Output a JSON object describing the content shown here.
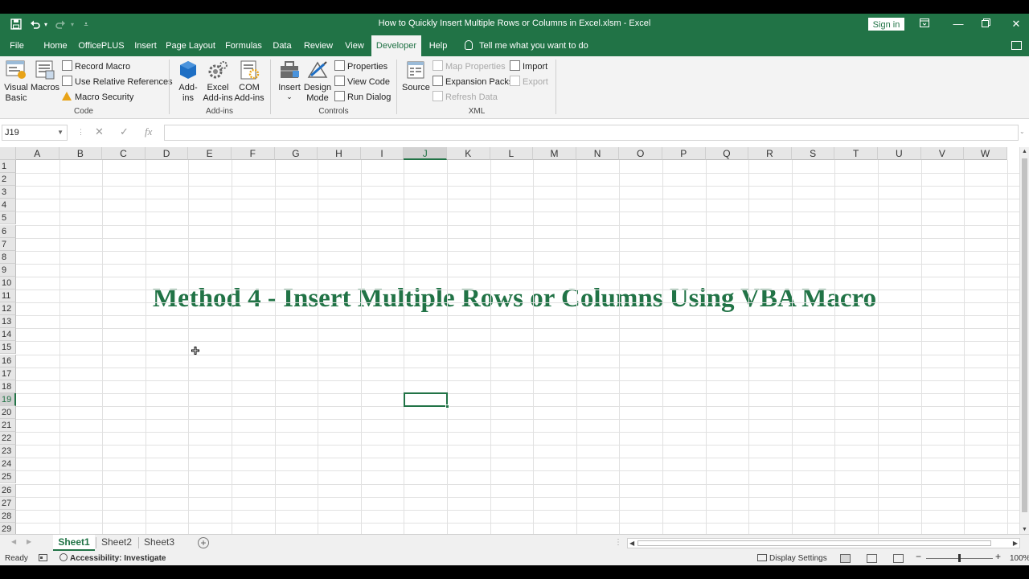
{
  "window": {
    "title": "How to Quickly Insert Multiple Rows or Columns in Excel.xlsm  -  Excel",
    "sign_in": "Sign in"
  },
  "tabs": [
    "File",
    "Home",
    "OfficePLUS",
    "Insert",
    "Page Layout",
    "Formulas",
    "Data",
    "Review",
    "View",
    "Developer",
    "Help"
  ],
  "active_tab": "Developer",
  "tell_me": "Tell me what you want to do",
  "ribbon": {
    "code": {
      "visual_basic_1": "Visual",
      "visual_basic_2": "Basic",
      "macros": "Macros",
      "record_macro": "Record Macro",
      "use_relative": "Use Relative References",
      "macro_security": "Macro Security",
      "label": "Code"
    },
    "addins": {
      "addins_1": "Add-",
      "addins_2": "ins",
      "excel_addins_1": "Excel",
      "excel_addins_2": "Add-ins",
      "com_addins_1": "COM",
      "com_addins_2": "Add-ins",
      "label": "Add-ins"
    },
    "controls": {
      "insert": "Insert",
      "insert_arrow": "⌄",
      "design_mode_1": "Design",
      "design_mode_2": "Mode",
      "properties": "Properties",
      "view_code": "View Code",
      "run_dialog": "Run Dialog",
      "label": "Controls"
    },
    "xml": {
      "source": "Source",
      "map_properties": "Map Properties",
      "expansion_packs": "Expansion Packs",
      "refresh_data": "Refresh Data",
      "import": "Import",
      "export": "Export",
      "label": "XML"
    }
  },
  "formula_bar": {
    "name_box": "J19",
    "fx": "fx",
    "cancel": "✕",
    "enter": "✓",
    "value": ""
  },
  "columns": [
    "A",
    "B",
    "C",
    "D",
    "E",
    "F",
    "G",
    "H",
    "I",
    "J",
    "K",
    "L",
    "M",
    "N",
    "O",
    "P",
    "Q",
    "R",
    "S",
    "T",
    "U",
    "V",
    "W"
  ],
  "rows": [
    "1",
    "2",
    "3",
    "4",
    "5",
    "6",
    "7",
    "8",
    "9",
    "10",
    "11",
    "12",
    "13",
    "14",
    "15",
    "16",
    "17",
    "18",
    "19",
    "20",
    "21",
    "22",
    "23",
    "24",
    "25",
    "26",
    "27",
    "28",
    "29"
  ],
  "selected_cell": "J19",
  "heading_text": "Method 4 - Insert Multiple Rows or Columns Using VBA Macro",
  "sheets": [
    "Sheet1",
    "Sheet2",
    "Sheet3"
  ],
  "active_sheet": "Sheet1",
  "status": {
    "ready": "Ready",
    "accessibility": "Accessibility: Investigate",
    "display_settings": "Display Settings",
    "zoom": "100%",
    "zoom_fraction": 0.5
  },
  "colors": {
    "excel_green": "#217346",
    "ribbon_bg": "#f3f3f3"
  }
}
